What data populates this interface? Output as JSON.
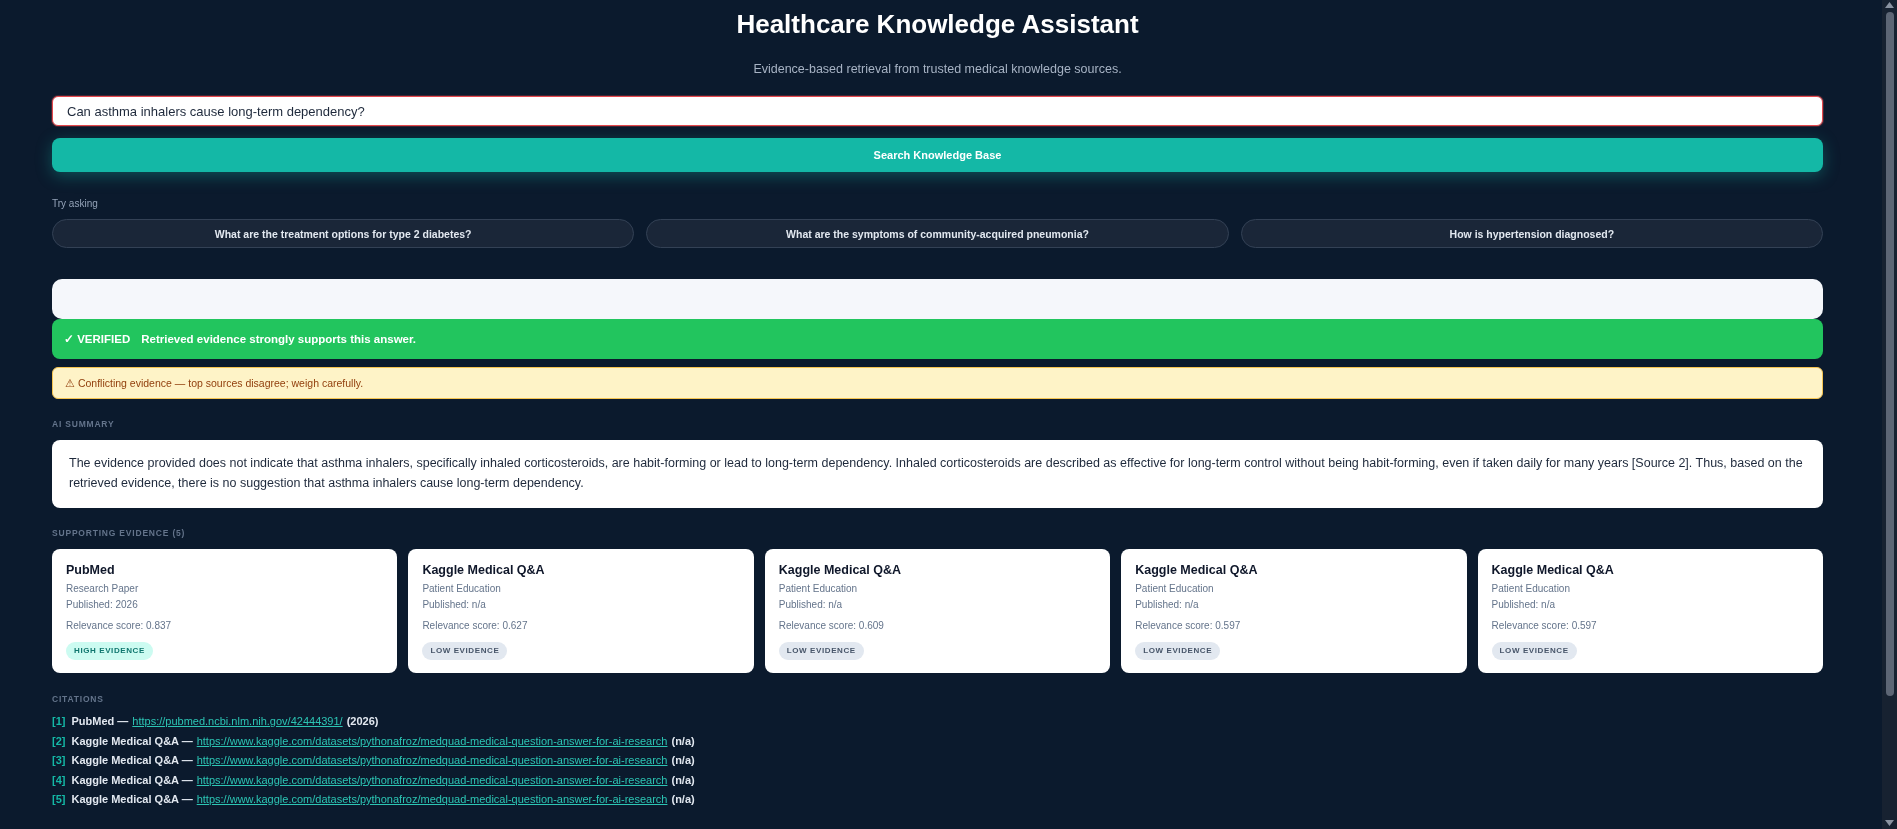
{
  "header": {
    "title": "Healthcare Knowledge Assistant",
    "subtitle": "Evidence-based retrieval from trusted medical knowledge sources."
  },
  "search": {
    "value": "Can asthma inhalers cause long-term dependency?",
    "focused": true
  },
  "search_button": {
    "label": "Search Knowledge Base"
  },
  "suggestions": {
    "label": "Try asking",
    "items": [
      "What are the treatment options for type 2 diabetes?",
      "What are the symptoms of community-acquired pneumonia?",
      "How is hypertension diagnosed?"
    ]
  },
  "verdict": {
    "kind": "verified",
    "label": "✓ VERIFIED",
    "message": "Retrieved evidence strongly supports this answer."
  },
  "warning": {
    "kind": "conflict",
    "text": "⚠ Conflicting evidence — top sources disagree; weigh carefully."
  },
  "summary": {
    "heading": "AI SUMMARY",
    "text": "The evidence provided does not indicate that asthma inhalers, specifically inhaled corticosteroids, are habit-forming or lead to long-term dependency. Inhaled corticosteroids are described as effective for long-term control without being habit-forming, even if taken daily for many years [Source 2]. Thus, based on the retrieved evidence, there is no suggestion that asthma inhalers cause long-term dependency."
  },
  "evidence": {
    "heading": "SUPPORTING EVIDENCE (5)",
    "cards": [
      {
        "source": "PubMed",
        "type": "Research Paper",
        "published": "Published: 2026",
        "relevance": "Relevance score: 0.837",
        "badge": {
          "label": "HIGH EVIDENCE",
          "kind": "high"
        }
      },
      {
        "source": "Kaggle Medical Q&A",
        "type": "Patient Education",
        "published": "Published: n/a",
        "relevance": "Relevance score: 0.627",
        "badge": {
          "label": "LOW EVIDENCE",
          "kind": "low"
        }
      },
      {
        "source": "Kaggle Medical Q&A",
        "type": "Patient Education",
        "published": "Published: n/a",
        "relevance": "Relevance score: 0.609",
        "badge": {
          "label": "LOW EVIDENCE",
          "kind": "low"
        }
      },
      {
        "source": "Kaggle Medical Q&A",
        "type": "Patient Education",
        "published": "Published: n/a",
        "relevance": "Relevance score: 0.597",
        "badge": {
          "label": "LOW EVIDENCE",
          "kind": "low"
        }
      },
      {
        "source": "Kaggle Medical Q&A",
        "type": "Patient Education",
        "published": "Published: n/a",
        "relevance": "Relevance score: 0.597",
        "badge": {
          "label": "LOW EVIDENCE",
          "kind": "low"
        }
      }
    ]
  },
  "citations": {
    "heading": "CITATIONS",
    "items": [
      {
        "index": "[1]",
        "source": "PubMed —",
        "url": "https://pubmed.ncbi.nlm.nih.gov/42444391/",
        "year": "(2026)"
      },
      {
        "index": "[2]",
        "source": "Kaggle Medical Q&A —",
        "url": "https://www.kaggle.com/datasets/pythonafroz/medquad-medical-question-answer-for-ai-research",
        "year": "(n/a)"
      },
      {
        "index": "[3]",
        "source": "Kaggle Medical Q&A —",
        "url": "https://www.kaggle.com/datasets/pythonafroz/medquad-medical-question-answer-for-ai-research",
        "year": "(n/a)"
      },
      {
        "index": "[4]",
        "source": "Kaggle Medical Q&A —",
        "url": "https://www.kaggle.com/datasets/pythonafroz/medquad-medical-question-answer-for-ai-research",
        "year": "(n/a)"
      },
      {
        "index": "[5]",
        "source": "Kaggle Medical Q&A —",
        "url": "https://www.kaggle.com/datasets/pythonafroz/medquad-medical-question-answer-for-ai-research",
        "year": "(n/a)"
      }
    ]
  }
}
